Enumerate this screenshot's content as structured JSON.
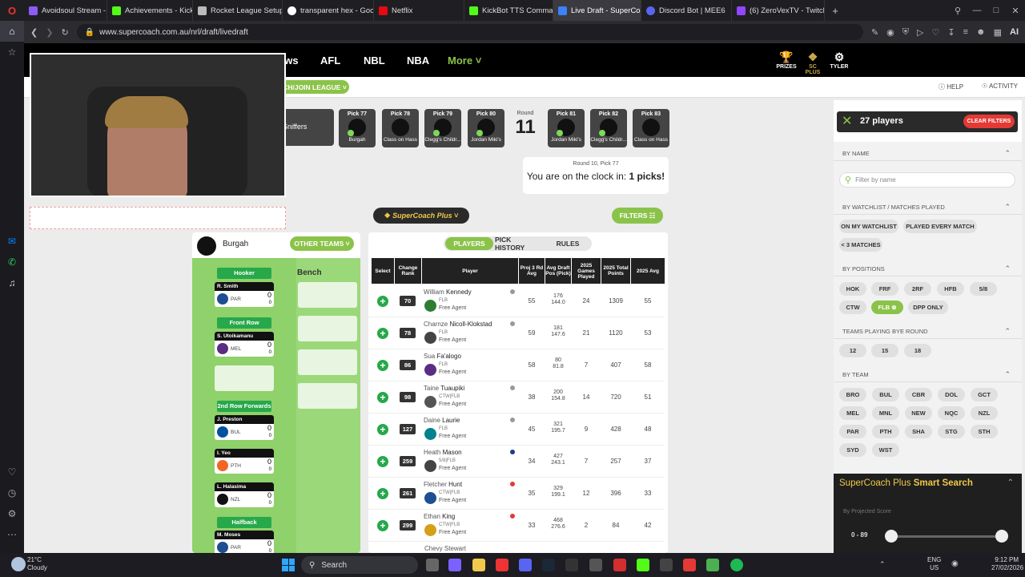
{
  "browser": {
    "tabs": [
      {
        "label": "Avoidsoul Stream - Watch",
        "color": "#8b5cf6"
      },
      {
        "label": "Achievements - Kick Dash",
        "color": "#53fc18"
      },
      {
        "label": "Rocket League Setup Guid",
        "color": "#bbbbbb"
      },
      {
        "label": "transparent hex - Google",
        "color": "#ffffff"
      },
      {
        "label": "Netflix",
        "color": "#e50914"
      },
      {
        "label": "KickBot TTS Commands",
        "color": "#53fc18"
      },
      {
        "label": "Live Draft - SuperCoach |",
        "color": "#3b82f6"
      },
      {
        "label": "Discord Bot | MEE6",
        "color": "#5865f2"
      },
      {
        "label": "(6) ZeroVexTV - Twitch",
        "color": "#9146ff"
      }
    ],
    "new_tab": "+",
    "url": "www.supercoach.com.au/nrl/draft/livedraft",
    "ai_label": "AI"
  },
  "nav": {
    "partial_news": "ews",
    "links": [
      "AFL",
      "NBL",
      "NBA",
      "More"
    ],
    "prizes": "PRIZES",
    "sc_plus": "SC PLUS",
    "user": "TYLER",
    "create_join": "CH/JOIN LEAGUE",
    "help": "HELP",
    "activity": "ACTIVITY"
  },
  "draft": {
    "team_partial": "Sniffers",
    "picks_left": [
      {
        "label": "Pick 77",
        "team": "Burgah"
      },
      {
        "label": "Pick 78",
        "team": "Class on Hass"
      },
      {
        "label": "Pick 79",
        "team": "Clegg's Childr..."
      },
      {
        "label": "Pick 80",
        "team": "Jordan Miki's"
      }
    ],
    "round_label": "Round",
    "round_number": "11",
    "picks_right": [
      {
        "label": "Pick 81",
        "team": "Jordan Miki's"
      },
      {
        "label": "Pick 82",
        "team": "Clegg's Childr..."
      },
      {
        "label": "Pick 83",
        "team": "Class on Hass"
      }
    ],
    "clock_sub": "Round 10, Pick 77",
    "clock_text": "You are on the clock in:",
    "clock_picks": "1 picks!"
  },
  "supercoach_plus": "SuperCoach Plus",
  "filters_button": "FILTERS",
  "team": {
    "name": "Burgah",
    "other_teams": "OTHER TEAMS",
    "bench_label": "Bench",
    "positions": {
      "hooker": "Hooker",
      "front_row": "Front Row",
      "second_row": "2nd Row Forwards",
      "halfback": "Halfback"
    },
    "players": [
      {
        "name": "R. Smith",
        "club": "PAR",
        "score": "0",
        "sub": "0"
      },
      {
        "name": "S. Utoikamanu",
        "club": "MEL",
        "score": "0",
        "sub": "0"
      },
      {
        "name": "J. Preston",
        "club": "BUL",
        "score": "0",
        "sub": "0"
      },
      {
        "name": "I. Yeo",
        "club": "PTH",
        "score": "0",
        "sub": "0"
      },
      {
        "name": "L. Halasima",
        "club": "NZL",
        "score": "0",
        "sub": "0"
      },
      {
        "name": "M. Moses",
        "club": "PAR",
        "score": "0",
        "sub": "0"
      }
    ]
  },
  "tabs": [
    "PLAYERS",
    "PICK HISTORY",
    "RULES"
  ],
  "table": {
    "headers": [
      "Select",
      "Change Rank",
      "Player",
      "Proj 3 Rd Avg",
      "Avg Draft Pos (Pick)",
      "2025 Games Played",
      "2025 Total Points",
      "2025 Avg"
    ],
    "rows": [
      {
        "rank": "70",
        "first": "William",
        "last": "Kennedy",
        "pos": "FLB",
        "status": "Free Agent",
        "proj": "55",
        "adp": "176",
        "adp2": "144.0",
        "games": "24",
        "total": "1309",
        "avg": "55"
      },
      {
        "rank": "78",
        "first": "Charnze",
        "last": "Nicoll-Klokstad",
        "pos": "FLB",
        "status": "Free Agent",
        "proj": "59",
        "adp": "181",
        "adp2": "147.6",
        "games": "21",
        "total": "1120",
        "avg": "53"
      },
      {
        "rank": "86",
        "first": "Sua",
        "last": "Fa'alogo",
        "pos": "FLB",
        "status": "Free Agent",
        "proj": "58",
        "adp": "80",
        "adp2": "81.8",
        "games": "7",
        "total": "407",
        "avg": "58"
      },
      {
        "rank": "98",
        "first": "Taine",
        "last": "Tuaupiki",
        "pos": "CTW|FLB",
        "status": "Free Agent",
        "proj": "38",
        "adp": "200",
        "adp2": "154.8",
        "games": "14",
        "total": "720",
        "avg": "51"
      },
      {
        "rank": "127",
        "first": "Daine",
        "last": "Laurie",
        "pos": "FLB",
        "status": "Free Agent",
        "proj": "45",
        "adp": "321",
        "adp2": "195.7",
        "games": "9",
        "total": "428",
        "avg": "48"
      },
      {
        "rank": "259",
        "first": "Heath",
        "last": "Mason",
        "pos": "5/8|FLB",
        "status": "Free Agent",
        "proj": "34",
        "adp": "427",
        "adp2": "243.1",
        "games": "7",
        "total": "257",
        "avg": "37"
      },
      {
        "rank": "261",
        "first": "Fletcher",
        "last": "Hunt",
        "pos": "CTW|FLB",
        "status": "Free Agent",
        "proj": "35",
        "adp": "329",
        "adp2": "199.1",
        "games": "12",
        "total": "396",
        "avg": "33"
      },
      {
        "rank": "299",
        "first": "Ethan",
        "last": "King",
        "pos": "CTW|FLB",
        "status": "Free Agent",
        "proj": "33",
        "adp": "468",
        "adp2": "276.6",
        "games": "2",
        "total": "84",
        "avg": "42"
      }
    ],
    "partial_row": "Chevy Stewart"
  },
  "filter_panel": {
    "count": "27 players",
    "clear": "CLEAR FILTERS",
    "by_name": "BY NAME",
    "placeholder": "Filter by name",
    "by_watch": "BY WATCHLIST / MATCHES PLAYED",
    "watch_chips": [
      "ON MY WATCHLIST",
      "PLAYED EVERY MATCH",
      "< 3 MATCHES"
    ],
    "by_pos": "BY POSITIONS",
    "pos_chips": [
      "HOK",
      "FRF",
      "2RF",
      "HFB",
      "5/8",
      "CTW",
      "FLB",
      "DPP ONLY"
    ],
    "by_bye": "TEAMS PLAYING BYE ROUND",
    "bye_chips": [
      "12",
      "15",
      "18"
    ],
    "by_team": "BY TEAM",
    "team_chips": [
      "BRO",
      "BUL",
      "CBR",
      "DOL",
      "GCT",
      "MEL",
      "MNL",
      "NEW",
      "NQC",
      "NZL",
      "PAR",
      "PTH",
      "SHA",
      "STG",
      "STH",
      "SYD",
      "WST"
    ],
    "smart_title_a": "SuperCoach Plus",
    "smart_title_b": "Smart Search",
    "smart_sub": "By Projected Score",
    "range": "0 - 89"
  },
  "taskbar": {
    "temp": "21°C",
    "weather": "Cloudy",
    "search": "Search",
    "lang": "ENG",
    "region": "US",
    "time": "9:12 PM",
    "date": "27/02/2026"
  }
}
